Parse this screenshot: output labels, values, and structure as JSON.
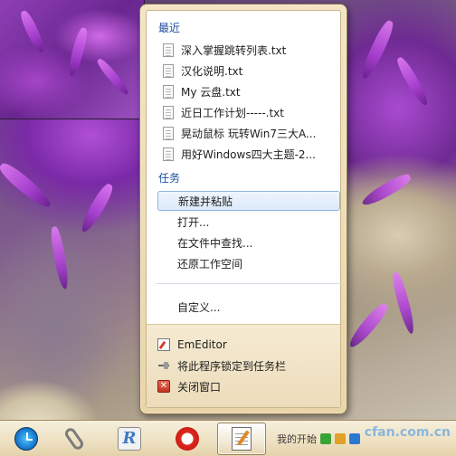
{
  "jumplist": {
    "recent_title": "最近",
    "recent_items": [
      {
        "label": "深入掌握跳转列表.txt",
        "icon": "text-document-icon"
      },
      {
        "label": "汉化说明.txt",
        "icon": "text-document-icon"
      },
      {
        "label": "My 云盘.txt",
        "icon": "text-document-icon"
      },
      {
        "label": "近日工作计划-----.txt",
        "icon": "text-document-icon"
      },
      {
        "label": "晃动鼠标 玩转Win7三大A...",
        "icon": "text-document-icon"
      },
      {
        "label": "用好Windows四大主题-2...",
        "icon": "text-document-icon"
      }
    ],
    "tasks_title": "任务",
    "task_items": [
      {
        "label": "新建并粘贴",
        "highlighted": true
      },
      {
        "label": "打开..."
      },
      {
        "label": "在文件中查找..."
      },
      {
        "label": "还原工作空间"
      }
    ],
    "custom_item": "自定义...",
    "footer_items": [
      {
        "label": "EmEditor",
        "icon": "emeditor-icon"
      },
      {
        "label": "将此程序锁定到任务栏",
        "icon": "pin-icon"
      },
      {
        "label": "关闭窗口",
        "icon": "close-window-icon"
      }
    ]
  },
  "taskbar": {
    "buttons": [
      {
        "icon": "clock-icon",
        "active": false
      },
      {
        "icon": "paperclip-icon",
        "active": false
      },
      {
        "icon": "r-app-icon",
        "active": false
      },
      {
        "icon": "red-fox-app-icon",
        "active": false
      },
      {
        "icon": "emeditor-notepad-icon",
        "active": true
      }
    ],
    "tray_text": "我的开始",
    "watermark": "cfan.com.cn"
  },
  "colors": {
    "section_title": "#1c4e9c",
    "jumplist_frame": "#e9d5a8",
    "highlight_border": "#8fb2de",
    "taskbar": "#efe2c4"
  }
}
